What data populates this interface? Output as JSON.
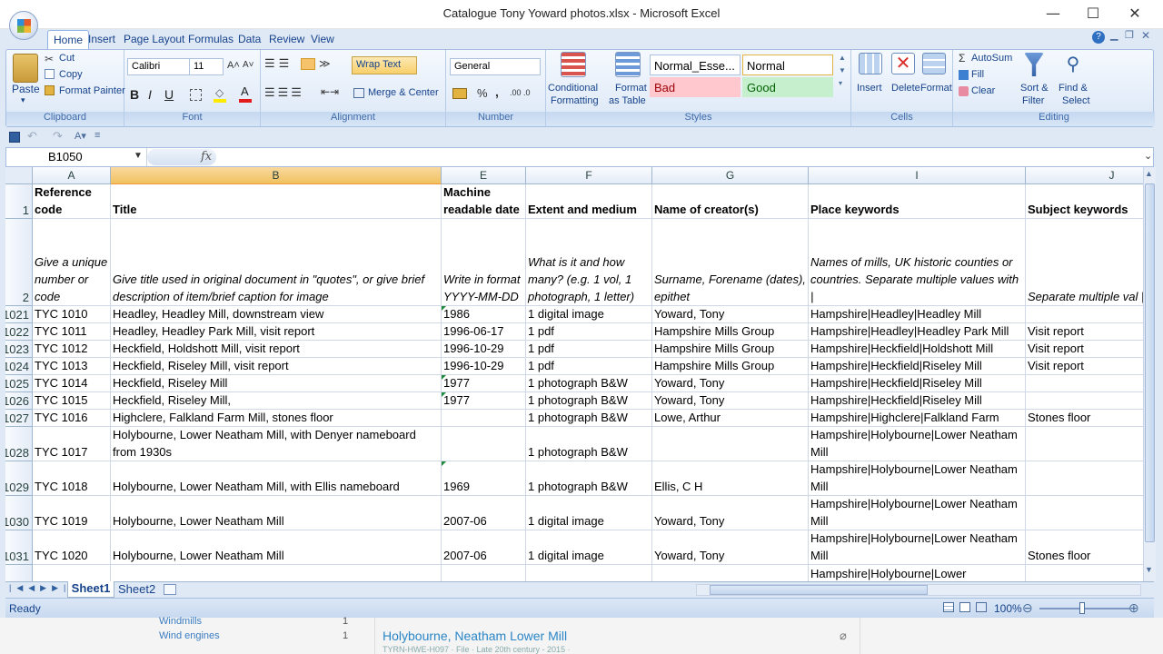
{
  "window": {
    "title": "Catalogue Tony Yoward photos.xlsx - Microsoft Excel",
    "minimize": "—",
    "maximize": "☐",
    "close": "✕"
  },
  "tabs": [
    "Home",
    "Insert",
    "Page Layout",
    "Formulas",
    "Data",
    "Review",
    "View"
  ],
  "ribbon": {
    "clipboard": {
      "paste": "Paste",
      "cut": "Cut",
      "copy": "Copy",
      "format_painter": "Format Painter",
      "label": "Clipboard"
    },
    "font": {
      "name": "Calibri",
      "size": "11",
      "bold": "B",
      "italic": "I",
      "underline": "U",
      "label": "Font"
    },
    "alignment": {
      "wrap_text": "Wrap Text",
      "merge_center": "Merge & Center",
      "label": "Alignment"
    },
    "number": {
      "format": "General",
      "percent": "%",
      "comma": ",",
      "label": "Number"
    },
    "styles": {
      "conditional": "Conditional",
      "conditional2": "Formatting",
      "format": "Format",
      "format2": "as Table",
      "normal_esse": "Normal_Esse...",
      "normal": "Normal",
      "bad": "Bad",
      "good": "Good",
      "label": "Styles"
    },
    "cells": {
      "insert": "Insert",
      "delete": "Delete",
      "format": "Format",
      "label": "Cells"
    },
    "editing": {
      "autosum": "AutoSum",
      "fill": "Fill",
      "clear": "Clear",
      "sort": "Sort &",
      "sort2": "Filter",
      "find": "Find &",
      "find2": "Select",
      "label": "Editing"
    }
  },
  "formula_bar": {
    "name_box": "B1050",
    "fx": "fx",
    "formula": ""
  },
  "columns": [
    "A",
    "B",
    "E",
    "F",
    "G",
    "I",
    "J"
  ],
  "header_rows": [
    {
      "num": "1",
      "cells": [
        "Reference code",
        "Title",
        "Machine readable date",
        "Extent and medium",
        "Name of creator(s)",
        "Place keywords",
        "Subject keywords"
      ]
    },
    {
      "num": "2",
      "cells": [
        "Give a unique number or code",
        "Give title used in original document in \"quotes\", or give brief description of item/brief caption for image",
        "Write in format YYYY-MM-DD",
        "What is it and how many? (e.g. 1 vol, 1 photograph, 1 letter)",
        "Surname, Forename (dates), epithet",
        "Names of mills, UK historic counties or countries. Separate multiple values with  |",
        "Separate multiple val |"
      ]
    }
  ],
  "rows": [
    {
      "num": "1021",
      "cells": [
        "TYC 1010",
        "Headley, Headley Mill, downstream view",
        "1986",
        "1 digital image",
        "Yoward, Tony",
        "Hampshire|Headley|Headley Mill",
        ""
      ]
    },
    {
      "num": "1022",
      "cells": [
        "TYC 1011",
        "Headley, Headley Park Mill, visit report",
        "1996-06-17",
        "1 pdf",
        "Hampshire Mills Group",
        "Hampshire|Headley|Headley Park Mill",
        "Visit report"
      ]
    },
    {
      "num": "1023",
      "cells": [
        "TYC 1012",
        "Heckfield, Holdshott Mill, visit report",
        "1996-10-29",
        "1 pdf",
        "Hampshire Mills Group",
        "Hampshire|Heckfield|Holdshott Mill",
        "Visit report"
      ]
    },
    {
      "num": "1024",
      "cells": [
        "TYC 1013",
        "Heckfield, Riseley Mill, visit report",
        "1996-10-29",
        "1 pdf",
        "Hampshire Mills Group",
        "Hampshire|Heckfield|Riseley Mill",
        "Visit report"
      ]
    },
    {
      "num": "1025",
      "cells": [
        "TYC 1014",
        "Heckfield, Riseley Mill",
        "1977",
        "1 photograph  B&W",
        "Yoward, Tony",
        "Hampshire|Heckfield|Riseley Mill",
        ""
      ]
    },
    {
      "num": "1026",
      "cells": [
        "TYC 1015",
        "Heckfield, Riseley Mill,",
        "1977",
        "1 photograph  B&W",
        "Yoward, Tony",
        "Hampshire|Heckfield|Riseley Mill",
        ""
      ]
    },
    {
      "num": "1027",
      "cells": [
        "TYC 1016",
        "Highclere, Falkland Farm Mill, stones floor",
        "",
        "1 photograph  B&W",
        "Lowe, Arthur",
        "Hampshire|Highclere|Falkland Farm",
        "Stones floor"
      ]
    },
    {
      "num": "1028",
      "cells": [
        "TYC 1017",
        "Holybourne, Lower Neatham Mill, with Denyer nameboard from 1930s",
        "",
        "1 photograph  B&W",
        "",
        "Hampshire|Holybourne|Lower Neatham Mill",
        ""
      ]
    },
    {
      "num": "1029",
      "cells": [
        "TYC 1018",
        "Holybourne, Lower Neatham Mill, with Ellis nameboard",
        "1969",
        "1 photograph  B&W",
        "Ellis, C H",
        "Hampshire|Holybourne|Lower Neatham Mill",
        ""
      ]
    },
    {
      "num": "1030",
      "cells": [
        "TYC 1019",
        "Holybourne, Lower Neatham Mill",
        "2007-06",
        "1 digital image",
        "Yoward, Tony",
        "Hampshire|Holybourne|Lower Neatham Mill",
        ""
      ]
    },
    {
      "num": "1031",
      "cells": [
        "TYC 1020",
        "Holybourne, Lower Neatham Mill",
        "2007-06",
        "1 digital image",
        "Yoward, Tony",
        "Hampshire|Holybourne|Lower Neatham Mill",
        "Stones floor"
      ]
    },
    {
      "num": "",
      "cells": [
        "",
        "",
        "",
        "",
        "",
        "Hampshire|Holybourne|Lower",
        ""
      ]
    }
  ],
  "sheets": [
    "Sheet1",
    "Sheet2"
  ],
  "status": {
    "ready": "Ready",
    "zoom": "100%"
  },
  "behind": {
    "item1": "Windmills",
    "item2": "Wind engines",
    "count1": "1",
    "count2": "1",
    "heading": "Holybourne, Neatham Lower Mill",
    "meta": "TYRN-HWE-H097 · File · Late 20th century - 2015 ·"
  }
}
